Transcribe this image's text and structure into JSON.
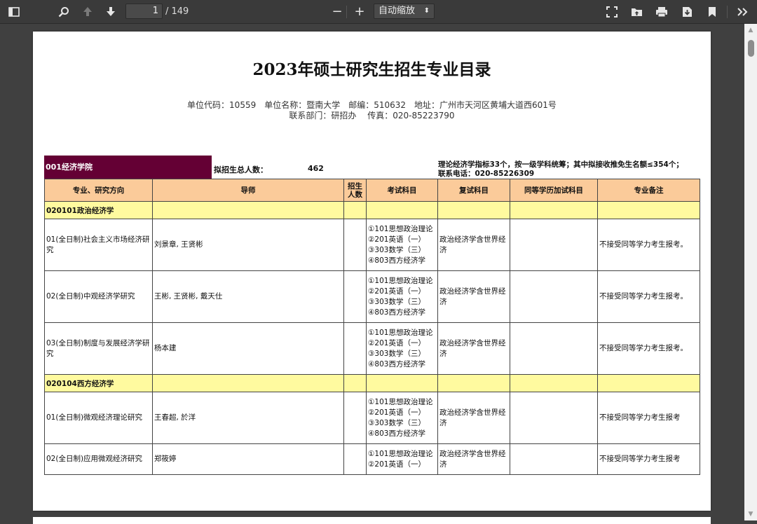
{
  "toolbar": {
    "page_current": "1",
    "page_total": "/ 149",
    "zoom_label": "自动缩放",
    "zoom_out": "−",
    "zoom_in": "+"
  },
  "document": {
    "title": "2023年硕士研究生招生专业目录",
    "info_line1": "单位代码：10559　单位名称：暨南大学　邮编：510632　地址：广州市天河区黄埔大道西601号",
    "info_line2": "联系部门：研招办　 传真：020-85223790",
    "college": "001经济学院",
    "enroll_label": "拟招生总人数：",
    "enroll_value": "462",
    "note_line1": "理论经济学指标33个，按一级学科统筹；其中拟接收推免生名额≤354个；",
    "note_line2": "联系电话：020-85226309"
  },
  "table": {
    "headers": [
      "专业、研究方向",
      "导师",
      "招生人数",
      "考试科目",
      "复试科目",
      "同等学历加试科目",
      "专业备注"
    ],
    "rows": [
      {
        "type": "subject",
        "major": "020101政治经济学"
      },
      {
        "type": "direction",
        "direction": "01(全日制)社会主义市场经济研究",
        "advisor": "刘景章, 王贤彬",
        "count": "",
        "exam": [
          "①101思想政治理论",
          "②201英语（一）",
          "③303数学（三）",
          "④803西方经济学"
        ],
        "retest": "政治经济学含世界经济",
        "extra": "",
        "remark": "不接受同等学力考生报考。"
      },
      {
        "type": "direction",
        "direction": "02(全日制)中观经济学研究",
        "advisor": "王彬, 王贤彬, 戴天仕",
        "count": "",
        "exam": [
          "①101思想政治理论",
          "②201英语（一）",
          "③303数学（三）",
          "④803西方经济学"
        ],
        "retest": "政治经济学含世界经济",
        "extra": "",
        "remark": "不接受同等学力考生报考。"
      },
      {
        "type": "direction",
        "direction": "03(全日制)制度与发展经济学研究",
        "advisor": "杨本建",
        "count": "",
        "exam": [
          "①101思想政治理论",
          "②201英语（一）",
          "③303数学（三）",
          "④803西方经济学"
        ],
        "retest": "政治经济学含世界经济",
        "extra": "",
        "remark": "不接受同等学力考生报考。"
      },
      {
        "type": "subject",
        "major": "020104西方经济学"
      },
      {
        "type": "direction",
        "direction": "01(全日制)微观经济理论研究",
        "advisor": "王春超, 於洋",
        "count": "",
        "exam": [
          "①101思想政治理论",
          "②201英语（一）",
          "③303数学（三）",
          "④803西方经济学"
        ],
        "retest": "政治经济学含世界经济",
        "extra": "",
        "remark": "不接受同等学力考生报考"
      },
      {
        "type": "direction",
        "direction": "02(全日制)应用微观经济研究",
        "advisor": "郑筱婷",
        "count": "",
        "exam": [
          "①101思想政治理论",
          "②201英语（一）"
        ],
        "retest": "政治经济学含世界经济",
        "extra": "",
        "remark": "不接受同等学力考生报考"
      }
    ]
  }
}
